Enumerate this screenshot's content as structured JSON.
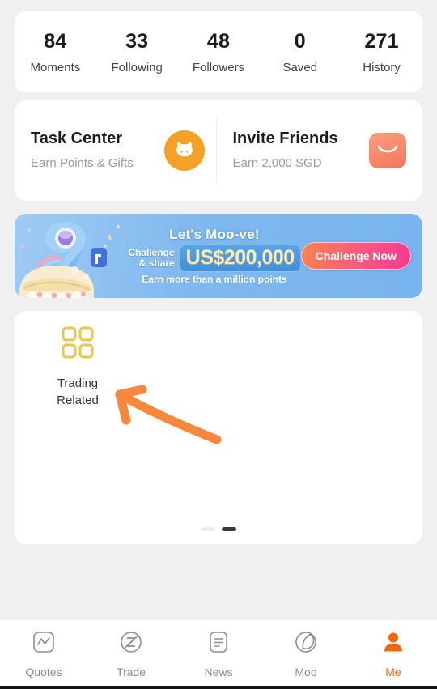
{
  "theme": {
    "page_bg": "#F0F0F0",
    "card_bg": "#FFFFFF",
    "accent_orange": "#F5670D",
    "task_icon_bg": "#F5A128",
    "invite_icon_bg": "#F4775C",
    "banner_bg": "#7FB8EF",
    "grid_icon_color": "#E8C84A",
    "annotation_color": "#F5883C"
  },
  "stats": [
    {
      "value": "84",
      "label": "Moments"
    },
    {
      "value": "33",
      "label": "Following"
    },
    {
      "value": "48",
      "label": "Followers"
    },
    {
      "value": "0",
      "label": "Saved"
    },
    {
      "value": "271",
      "label": "History"
    }
  ],
  "promos": {
    "task_center": {
      "title": "Task Center",
      "subtitle": "Earn Points & Gifts",
      "icon": "cow-face-icon"
    },
    "invite_friends": {
      "title": "Invite Friends",
      "subtitle": "Earn 2,000 SGD",
      "icon": "gift-bag-icon"
    }
  },
  "banner": {
    "headline": "Let's Moo-ve!",
    "challenge_line1": "Challenge",
    "challenge_line2": "& share",
    "amount": "US$200,000",
    "footnote": "Earn more than a million points",
    "button_label": "Challenge Now",
    "artwork": "anniversary-9-cake-icon"
  },
  "tools": {
    "items": [
      {
        "label": "Trading\nRelated",
        "icon": "grid-icon"
      }
    ],
    "pagination": {
      "total": 2,
      "active_index": 1
    }
  },
  "annotation": {
    "type": "arrow",
    "direction": "up-left",
    "target": "trading-related-tile"
  },
  "tabbar": {
    "active": "Me",
    "items": [
      {
        "label": "Quotes",
        "icon": "chart-square-icon"
      },
      {
        "label": "Trade",
        "icon": "trade-circle-z-icon"
      },
      {
        "label": "News",
        "icon": "document-lines-icon"
      },
      {
        "label": "Moo",
        "icon": "moon-circle-icon"
      },
      {
        "label": "Me",
        "icon": "person-icon"
      }
    ]
  }
}
